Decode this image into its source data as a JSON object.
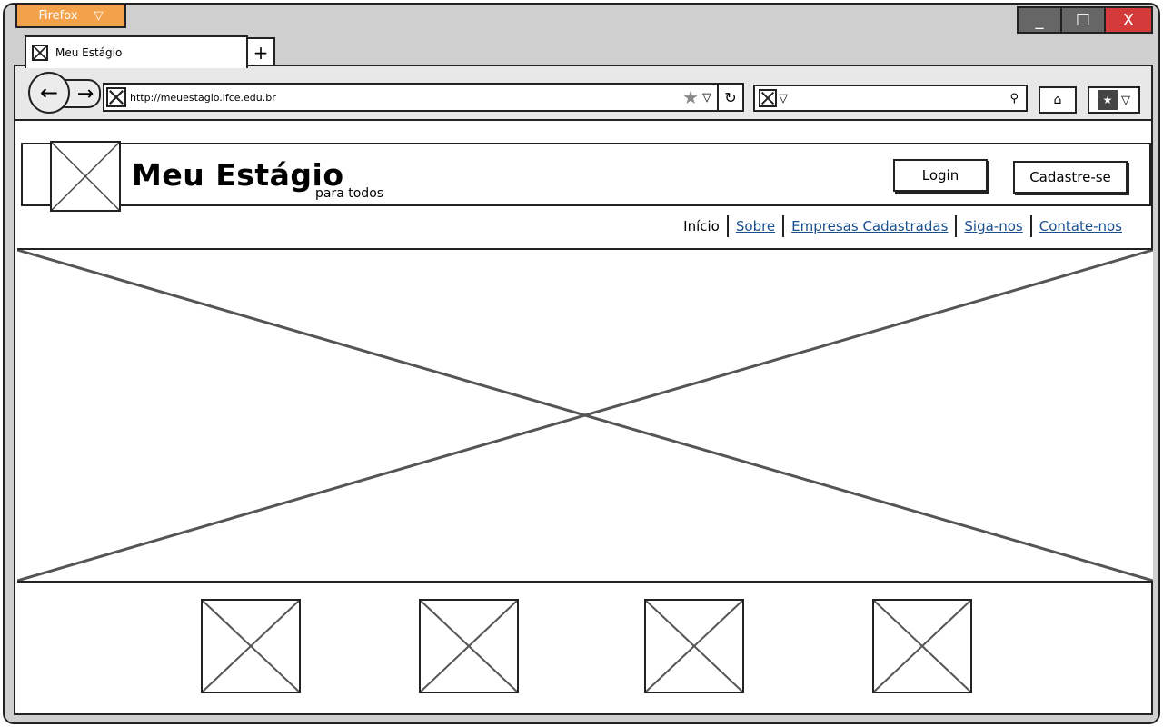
{
  "browser": {
    "app_button_label": "Firefox",
    "app_button_arrow": "▽",
    "window_controls": {
      "minimize": "_",
      "maximize": "☐",
      "close": "X"
    },
    "tab": {
      "title": "Meu Estágio",
      "icon": "image-placeholder-icon"
    },
    "new_tab_label": "+",
    "nav": {
      "back": "←",
      "forward": "→"
    },
    "address_bar": {
      "url": "http://meuestagio.ifce.edu.br",
      "bookmark_star": "★",
      "dropdown_arrow": "▽",
      "reload": "↻"
    },
    "search_bar": {
      "dropdown_arrow": "▽",
      "search_glyph": "⚲"
    },
    "home_glyph": "⌂",
    "bookmarks": {
      "glyph": "★",
      "arrow": "▽"
    }
  },
  "site": {
    "title": "Meu Estágio",
    "subtitle": "para todos",
    "login_label": "Login",
    "signup_label": "Cadastre-se",
    "menu": [
      "Início",
      "Sobre",
      "Empresas Cadastradas",
      "Siga-nos",
      "Contate-nos"
    ]
  },
  "colors": {
    "firefox_orange": "#f3a14a",
    "link_blue": "#1b4f8c",
    "close_red": "#d53a3a",
    "chrome_gray": "#cfcfcf"
  }
}
